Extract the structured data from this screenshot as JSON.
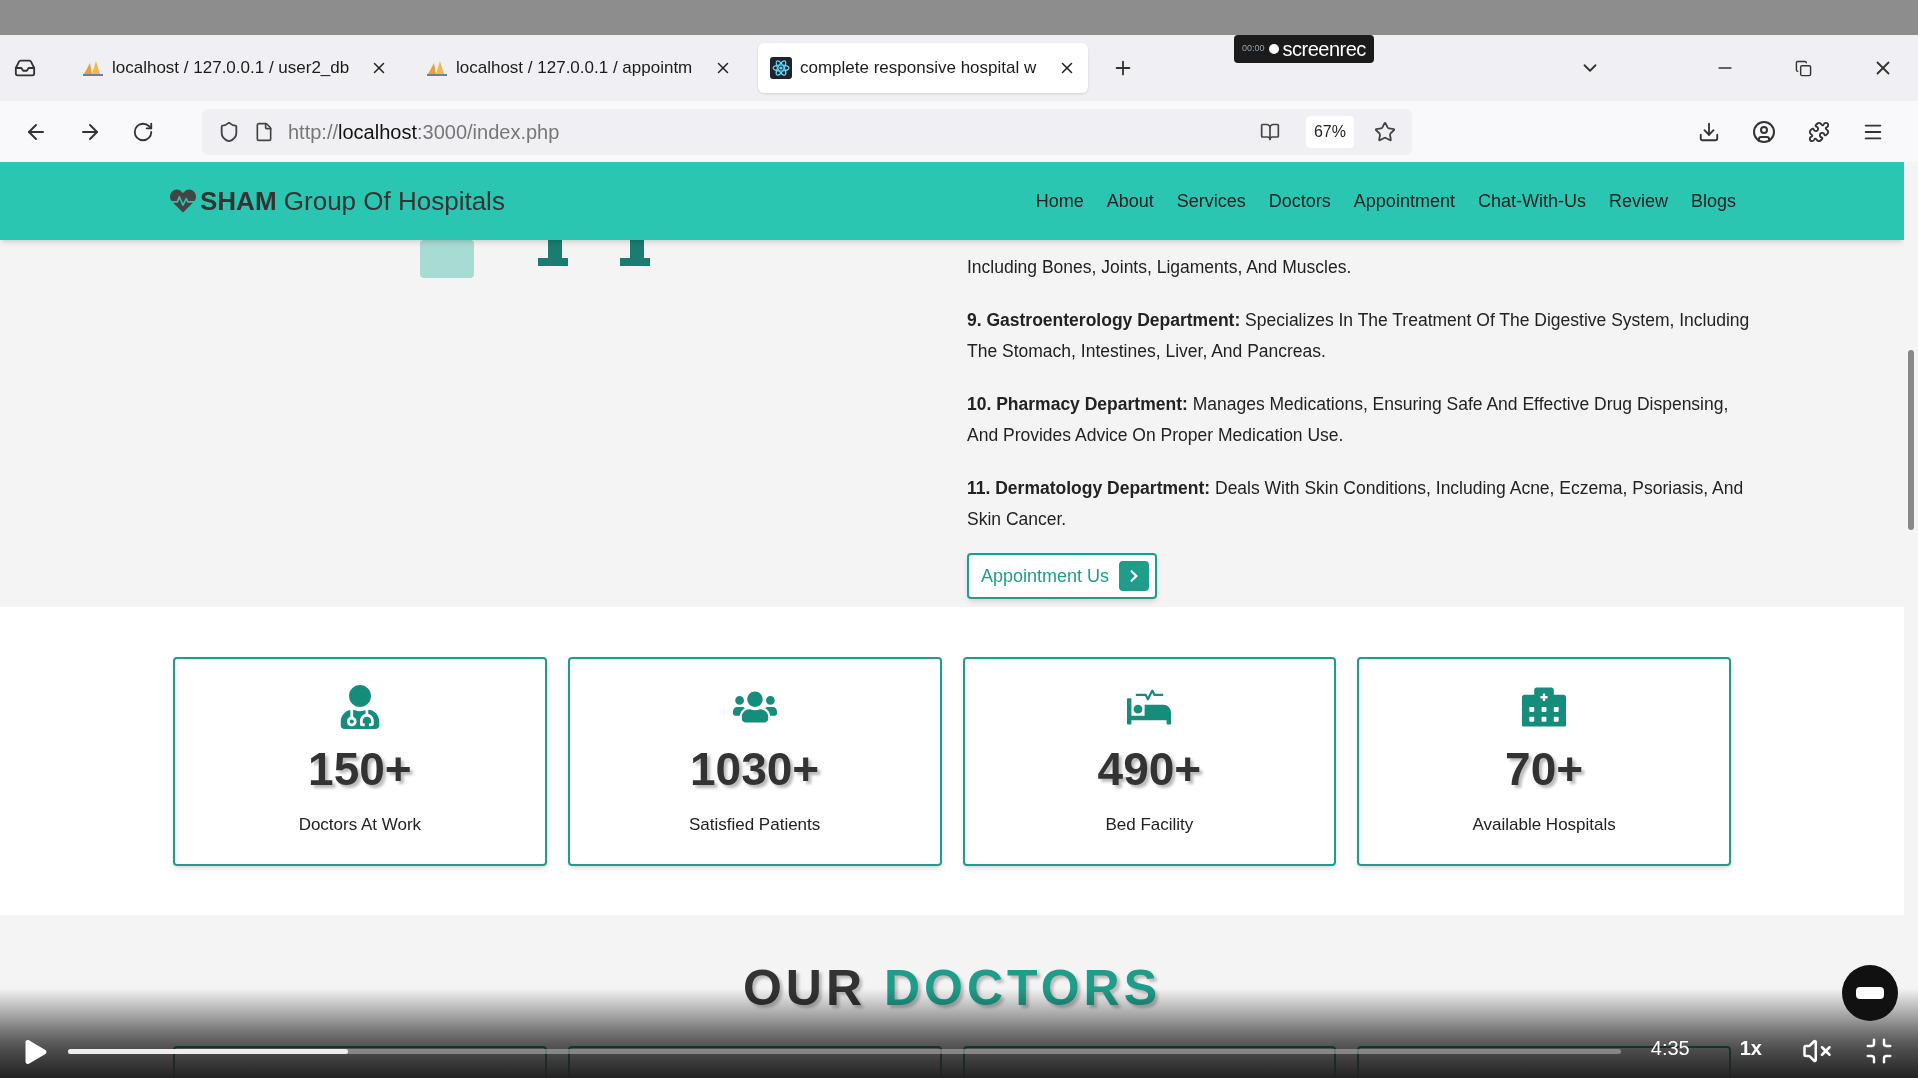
{
  "recorder_badge": {
    "time": "00:00",
    "label": "screenrec"
  },
  "browser": {
    "tabs": [
      {
        "title": "localhost / 127.0.0.1 / user2_db",
        "selected": false
      },
      {
        "title": "localhost / 127.0.0.1 / appointm",
        "selected": false
      },
      {
        "title": "complete responsive hospital w",
        "selected": true
      }
    ],
    "url_prefix": "http://",
    "url_host": "localhost",
    "url_rest": ":3000/index.php",
    "zoom": "67%"
  },
  "site": {
    "logo_bold": "SHAM",
    "logo_rest": "Group Of Hospitals",
    "nav": [
      "Home",
      "About",
      "Services",
      "Doctors",
      "Appointment",
      "Chat-With-Us",
      "Review",
      "Blogs"
    ],
    "paragraphs": [
      "Including Bones, Joints, Ligaments, And Muscles.",
      "**9. Gastroenterology Department:** Specializes In The Treatment Of The Digestive System, Including The Stomach, Intestines, Liver, And Pancreas.",
      "**10. Pharmacy Department:** Manages Medications, Ensuring Safe And Effective Drug Dispensing, And Provides Advice On Proper Medication Use.",
      "**11. Dermatology Department:** Deals With Skin Conditions, Including Acne, Eczema, Psoriasis, And Skin Cancer."
    ],
    "button": "Appointment Us",
    "stats": [
      {
        "number": "150+",
        "label": "Doctors At Work"
      },
      {
        "number": "1030+",
        "label": "Satisfied Patients"
      },
      {
        "number": "490+",
        "label": "Bed Facility"
      },
      {
        "number": "70+",
        "label": "Available Hospitals"
      }
    ],
    "section_title_dark": "OUR",
    "section_title_accent": "DOCTORS"
  },
  "player": {
    "level": 0.18,
    "time": "4:35",
    "speed": "1x"
  }
}
